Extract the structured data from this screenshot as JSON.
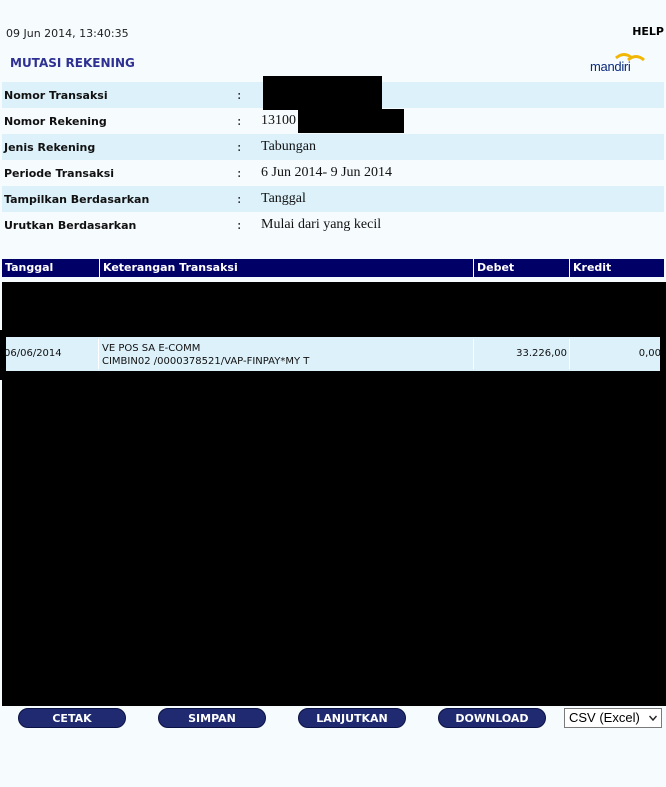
{
  "header": {
    "timestamp": "09 Jun 2014, 13:40:35",
    "help_label": "HELP",
    "title": "MUTASI REKENING",
    "logo_text": "mandiri"
  },
  "info": [
    {
      "label": "Nomor Transaksi",
      "value": ""
    },
    {
      "label": "Nomor Rekening",
      "value": "13100"
    },
    {
      "label": "Jenis Rekening",
      "value": "Tabungan"
    },
    {
      "label": "Periode Transaksi",
      "value": "6 Jun 2014- 9 Jun 2014"
    },
    {
      "label": "Tampilkan Berdasarkan",
      "value": "Tanggal"
    },
    {
      "label": "Urutkan Berdasarkan",
      "value": "Mulai dari yang kecil"
    }
  ],
  "colon": ":",
  "table": {
    "columns": [
      "Tanggal",
      "Keterangan Transaksi",
      "Debet",
      "Kredit"
    ],
    "rows": [
      {
        "tanggal": "06/06/2014",
        "keterangan_1": "VE POS SA E-COMM",
        "keterangan_2": "CIMBIN02 /0000378521/VAP-FINPAY*MY T",
        "debet": "33.226,00",
        "kredit": "0,00"
      }
    ]
  },
  "buttons": {
    "cetak": "CETAK",
    "simpan": "SIMPAN",
    "lanjutkan": "LANJUTKAN",
    "download": "DOWNLOAD"
  },
  "format_select": {
    "selected": "CSV (Excel)"
  },
  "colors": {
    "header_bg": "#000066",
    "row_alt": "#dcf1fa",
    "title": "#2e3192",
    "button_bg": "#1f2a70",
    "logo_swoosh": "#f2b705"
  }
}
